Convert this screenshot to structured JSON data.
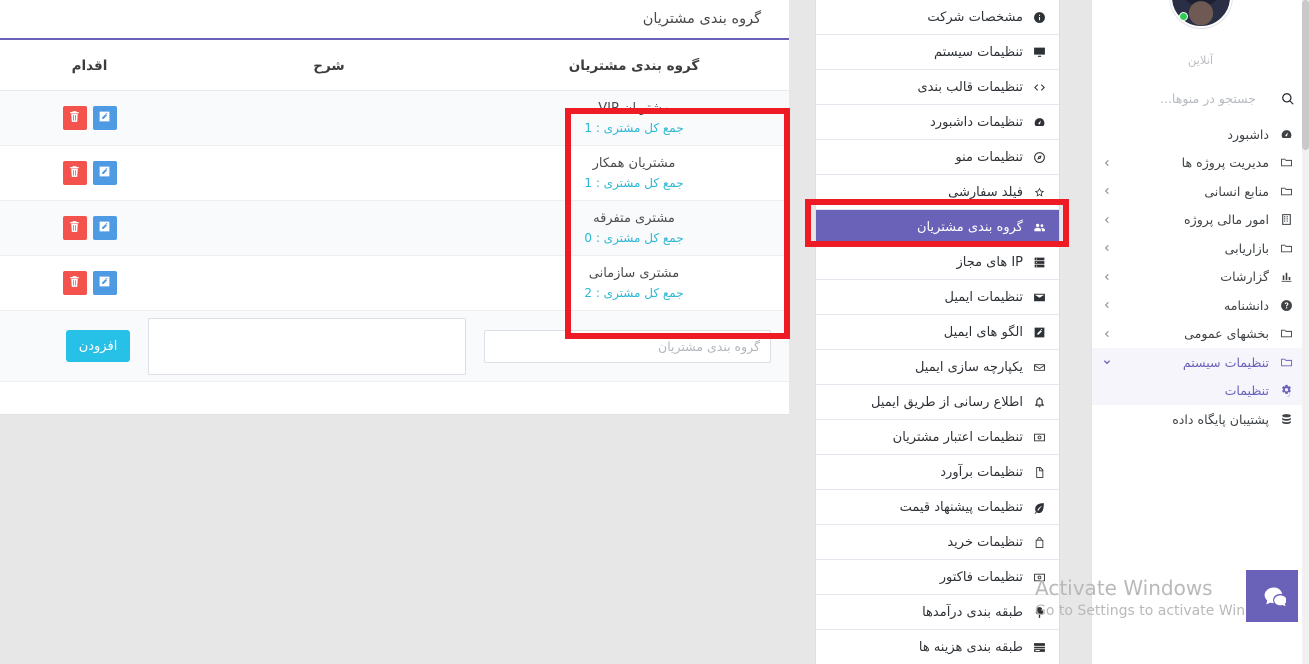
{
  "card": {
    "title": "گروه بندی مشتریان",
    "columns": {
      "group": "گروه بندی مشتریان",
      "description": "شرح",
      "actions": "اقدام"
    },
    "rows": [
      {
        "name": "مشتریان VIP",
        "count_label": "جمع کل مشتری : 1",
        "description": ""
      },
      {
        "name": "مشتریان همکار",
        "count_label": "جمع کل مشتری : 1",
        "description": ""
      },
      {
        "name": "مشتری متفرقه",
        "count_label": "جمع کل مشتری : 0",
        "description": ""
      },
      {
        "name": "مشتری سازمانی",
        "count_label": "جمع کل مشتری : 2",
        "description": ""
      }
    ],
    "add_form": {
      "name_placeholder": "گروه بندی مشتریان",
      "name_value": "",
      "description_value": "",
      "submit_label": "افزودن"
    },
    "row_buttons": {
      "delete": "حذف",
      "edit": "ویرایش"
    }
  },
  "menu_panel": {
    "items": [
      {
        "label": "مشخصات شرکت",
        "icon": "info-icon",
        "active": false
      },
      {
        "label": "تنظیمات سیستم",
        "icon": "monitor-icon",
        "active": false
      },
      {
        "label": "تنظیمات قالب بندی",
        "icon": "code-icon",
        "active": false
      },
      {
        "label": "تنظیمات داشبورد",
        "icon": "dashboard-icon",
        "active": false
      },
      {
        "label": "تنظیمات منو",
        "icon": "compass-icon",
        "active": false
      },
      {
        "label": "فیلد سفارشی",
        "icon": "star-icon",
        "active": false
      },
      {
        "label": "گروه بندی مشتریان",
        "icon": "users-icon",
        "active": true
      },
      {
        "label": "IP های مجاز",
        "icon": "server-icon",
        "active": false
      },
      {
        "label": "تنظیمات ایمیل",
        "icon": "envelope-solid-icon",
        "active": false
      },
      {
        "label": "الگو های ایمیل",
        "icon": "pencil-square-icon",
        "active": false
      },
      {
        "label": "یکپارچه سازی ایمیل",
        "icon": "envelope-open-icon",
        "active": false
      },
      {
        "label": "اطلاع رسانی از طریق ایمیل",
        "icon": "bell-icon",
        "active": false
      },
      {
        "label": "تنظیمات اعتبار مشتریان",
        "icon": "money-icon",
        "active": false
      },
      {
        "label": "تنظیمات برآورد",
        "icon": "file-icon",
        "active": false
      },
      {
        "label": "تنظیمات پیشنهاد قیمت",
        "icon": "leaf-icon",
        "active": false
      },
      {
        "label": "تنظیمات خرید",
        "icon": "bag-icon",
        "active": false
      },
      {
        "label": "تنظیمات فاکتور",
        "icon": "money-icon",
        "active": false
      },
      {
        "label": "طبقه بندی درآمدها",
        "icon": "tree-icon",
        "active": false
      },
      {
        "label": "طبقه بندی هزینه ها",
        "icon": "stack-icon",
        "active": false
      }
    ]
  },
  "sidebar": {
    "status": "آنلاین",
    "search_placeholder": "جستجو در منوها...",
    "search_value": "",
    "items": [
      {
        "label": "داشبورد",
        "icon": "dashboard-icon",
        "chevron": false,
        "active": false,
        "sub": false
      },
      {
        "label": "مدیریت پروژه ها",
        "icon": "folder-icon",
        "chevron": true,
        "active": false,
        "sub": false
      },
      {
        "label": "منابع انسانی",
        "icon": "folder-icon",
        "chevron": true,
        "active": false,
        "sub": false
      },
      {
        "label": "امور مالی پروژه",
        "icon": "building-icon",
        "chevron": true,
        "active": false,
        "sub": false
      },
      {
        "label": "بازاریابی",
        "icon": "folder-icon",
        "chevron": true,
        "active": false,
        "sub": false
      },
      {
        "label": "گزارشات",
        "icon": "chart-icon",
        "chevron": true,
        "active": false,
        "sub": false
      },
      {
        "label": "دانشنامه",
        "icon": "question-icon",
        "chevron": true,
        "active": false,
        "sub": false
      },
      {
        "label": "بخشهای عمومی",
        "icon": "folder-icon",
        "chevron": true,
        "active": false,
        "sub": false
      },
      {
        "label": "تنظیمات سیستم",
        "icon": "folder-icon",
        "chevron": "down",
        "active": true,
        "sub": false
      },
      {
        "label": "تنظیمات",
        "icon": "cogs-icon",
        "chevron": false,
        "active": true,
        "sub": true
      },
      {
        "label": "پشتیبان پایگاه داده",
        "icon": "database-icon",
        "chevron": false,
        "active": false,
        "sub": true
      }
    ]
  },
  "watermark": {
    "title": "Activate Windows",
    "subtitle": "Go to Settings to activate Windows."
  },
  "chat": {
    "label": "گفتگو"
  },
  "theme": {
    "accent_purple": "#6a62b8",
    "delete_red": "#f4534d",
    "edit_blue": "#4e9ae3",
    "add_cyan": "#27c1e8",
    "count_cyan": "#2cb7d4",
    "annotation_red": "#ee1b24",
    "online_green": "#2ecc52"
  }
}
